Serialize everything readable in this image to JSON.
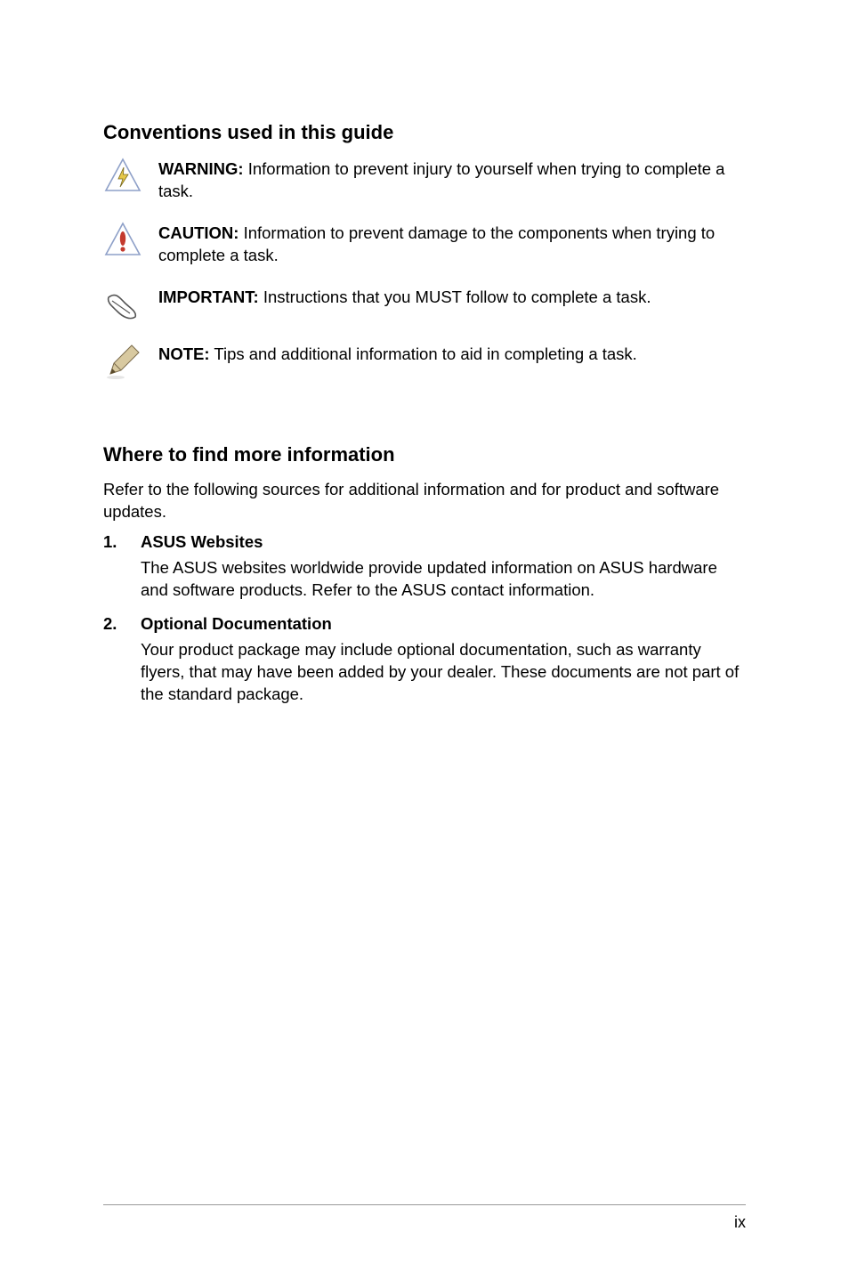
{
  "conventions": {
    "heading": "Conventions used in this guide",
    "items": [
      {
        "label": "WARNING:",
        "text": " Information to prevent injury to yourself when trying to complete a task.",
        "icon": "warning-bolt-icon"
      },
      {
        "label": "CAUTION:",
        "text": " Information to prevent damage to the components when trying to complete a task.",
        "icon": "caution-exclaim-icon"
      },
      {
        "label": "IMPORTANT:",
        "text": " Instructions that you MUST follow to complete a task.",
        "icon": "hand-pointing-icon"
      },
      {
        "label": "NOTE:",
        "text": " Tips and additional information to aid in completing a task.",
        "icon": "pencil-note-icon"
      }
    ]
  },
  "moreinfo": {
    "heading": "Where to find more information",
    "intro": "Refer to the following sources for additional information and for product and software updates.",
    "items": [
      {
        "index": "1.",
        "title": "ASUS Websites",
        "text": "The ASUS websites worldwide provide updated information on ASUS hardware and software products. Refer to the ASUS contact information."
      },
      {
        "index": "2.",
        "title": "Optional Documentation",
        "text": "Your product package may include optional documentation, such as warranty flyers, that may have been added by your dealer. These documents are not part of the standard package."
      }
    ]
  },
  "page_number": "ix"
}
